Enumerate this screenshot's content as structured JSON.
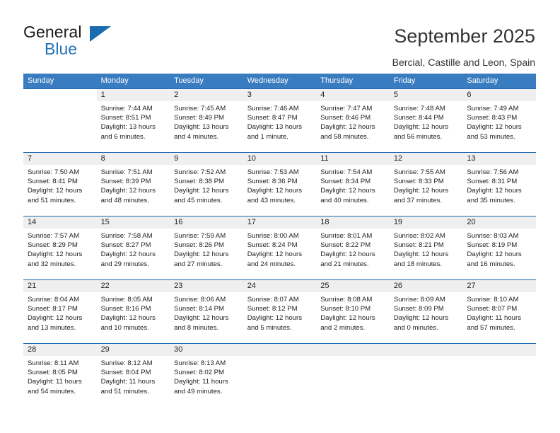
{
  "brand": {
    "line1": "General",
    "line2": "Blue",
    "accent": "#1b6cb0"
  },
  "header": {
    "title": "September 2025",
    "subtitle": "Bercial, Castille and Leon, Spain"
  },
  "calendar": {
    "header_bg": "#3a7cc0",
    "daynum_bg": "#efefef",
    "separator_color": "#1b6cb0",
    "weekdays": [
      "Sunday",
      "Monday",
      "Tuesday",
      "Wednesday",
      "Thursday",
      "Friday",
      "Saturday"
    ],
    "weeks": [
      [
        {
          "day": "",
          "blank": true,
          "sunrise": "",
          "sunset": "",
          "daylight1": "",
          "daylight2": ""
        },
        {
          "day": "1",
          "sunrise": "Sunrise: 7:44 AM",
          "sunset": "Sunset: 8:51 PM",
          "daylight1": "Daylight: 13 hours",
          "daylight2": "and 6 minutes."
        },
        {
          "day": "2",
          "sunrise": "Sunrise: 7:45 AM",
          "sunset": "Sunset: 8:49 PM",
          "daylight1": "Daylight: 13 hours",
          "daylight2": "and 4 minutes."
        },
        {
          "day": "3",
          "sunrise": "Sunrise: 7:46 AM",
          "sunset": "Sunset: 8:47 PM",
          "daylight1": "Daylight: 13 hours",
          "daylight2": "and 1 minute."
        },
        {
          "day": "4",
          "sunrise": "Sunrise: 7:47 AM",
          "sunset": "Sunset: 8:46 PM",
          "daylight1": "Daylight: 12 hours",
          "daylight2": "and 58 minutes."
        },
        {
          "day": "5",
          "sunrise": "Sunrise: 7:48 AM",
          "sunset": "Sunset: 8:44 PM",
          "daylight1": "Daylight: 12 hours",
          "daylight2": "and 56 minutes."
        },
        {
          "day": "6",
          "sunrise": "Sunrise: 7:49 AM",
          "sunset": "Sunset: 8:43 PM",
          "daylight1": "Daylight: 12 hours",
          "daylight2": "and 53 minutes."
        }
      ],
      [
        {
          "day": "7",
          "sunrise": "Sunrise: 7:50 AM",
          "sunset": "Sunset: 8:41 PM",
          "daylight1": "Daylight: 12 hours",
          "daylight2": "and 51 minutes."
        },
        {
          "day": "8",
          "sunrise": "Sunrise: 7:51 AM",
          "sunset": "Sunset: 8:39 PM",
          "daylight1": "Daylight: 12 hours",
          "daylight2": "and 48 minutes."
        },
        {
          "day": "9",
          "sunrise": "Sunrise: 7:52 AM",
          "sunset": "Sunset: 8:38 PM",
          "daylight1": "Daylight: 12 hours",
          "daylight2": "and 45 minutes."
        },
        {
          "day": "10",
          "sunrise": "Sunrise: 7:53 AM",
          "sunset": "Sunset: 8:36 PM",
          "daylight1": "Daylight: 12 hours",
          "daylight2": "and 43 minutes."
        },
        {
          "day": "11",
          "sunrise": "Sunrise: 7:54 AM",
          "sunset": "Sunset: 8:34 PM",
          "daylight1": "Daylight: 12 hours",
          "daylight2": "and 40 minutes."
        },
        {
          "day": "12",
          "sunrise": "Sunrise: 7:55 AM",
          "sunset": "Sunset: 8:33 PM",
          "daylight1": "Daylight: 12 hours",
          "daylight2": "and 37 minutes."
        },
        {
          "day": "13",
          "sunrise": "Sunrise: 7:56 AM",
          "sunset": "Sunset: 8:31 PM",
          "daylight1": "Daylight: 12 hours",
          "daylight2": "and 35 minutes."
        }
      ],
      [
        {
          "day": "14",
          "sunrise": "Sunrise: 7:57 AM",
          "sunset": "Sunset: 8:29 PM",
          "daylight1": "Daylight: 12 hours",
          "daylight2": "and 32 minutes."
        },
        {
          "day": "15",
          "sunrise": "Sunrise: 7:58 AM",
          "sunset": "Sunset: 8:27 PM",
          "daylight1": "Daylight: 12 hours",
          "daylight2": "and 29 minutes."
        },
        {
          "day": "16",
          "sunrise": "Sunrise: 7:59 AM",
          "sunset": "Sunset: 8:26 PM",
          "daylight1": "Daylight: 12 hours",
          "daylight2": "and 27 minutes."
        },
        {
          "day": "17",
          "sunrise": "Sunrise: 8:00 AM",
          "sunset": "Sunset: 8:24 PM",
          "daylight1": "Daylight: 12 hours",
          "daylight2": "and 24 minutes."
        },
        {
          "day": "18",
          "sunrise": "Sunrise: 8:01 AM",
          "sunset": "Sunset: 8:22 PM",
          "daylight1": "Daylight: 12 hours",
          "daylight2": "and 21 minutes."
        },
        {
          "day": "19",
          "sunrise": "Sunrise: 8:02 AM",
          "sunset": "Sunset: 8:21 PM",
          "daylight1": "Daylight: 12 hours",
          "daylight2": "and 18 minutes."
        },
        {
          "day": "20",
          "sunrise": "Sunrise: 8:03 AM",
          "sunset": "Sunset: 8:19 PM",
          "daylight1": "Daylight: 12 hours",
          "daylight2": "and 16 minutes."
        }
      ],
      [
        {
          "day": "21",
          "sunrise": "Sunrise: 8:04 AM",
          "sunset": "Sunset: 8:17 PM",
          "daylight1": "Daylight: 12 hours",
          "daylight2": "and 13 minutes."
        },
        {
          "day": "22",
          "sunrise": "Sunrise: 8:05 AM",
          "sunset": "Sunset: 8:16 PM",
          "daylight1": "Daylight: 12 hours",
          "daylight2": "and 10 minutes."
        },
        {
          "day": "23",
          "sunrise": "Sunrise: 8:06 AM",
          "sunset": "Sunset: 8:14 PM",
          "daylight1": "Daylight: 12 hours",
          "daylight2": "and 8 minutes."
        },
        {
          "day": "24",
          "sunrise": "Sunrise: 8:07 AM",
          "sunset": "Sunset: 8:12 PM",
          "daylight1": "Daylight: 12 hours",
          "daylight2": "and 5 minutes."
        },
        {
          "day": "25",
          "sunrise": "Sunrise: 8:08 AM",
          "sunset": "Sunset: 8:10 PM",
          "daylight1": "Daylight: 12 hours",
          "daylight2": "and 2 minutes."
        },
        {
          "day": "26",
          "sunrise": "Sunrise: 8:09 AM",
          "sunset": "Sunset: 8:09 PM",
          "daylight1": "Daylight: 12 hours",
          "daylight2": "and 0 minutes."
        },
        {
          "day": "27",
          "sunrise": "Sunrise: 8:10 AM",
          "sunset": "Sunset: 8:07 PM",
          "daylight1": "Daylight: 11 hours",
          "daylight2": "and 57 minutes."
        }
      ],
      [
        {
          "day": "28",
          "sunrise": "Sunrise: 8:11 AM",
          "sunset": "Sunset: 8:05 PM",
          "daylight1": "Daylight: 11 hours",
          "daylight2": "and 54 minutes."
        },
        {
          "day": "29",
          "sunrise": "Sunrise: 8:12 AM",
          "sunset": "Sunset: 8:04 PM",
          "daylight1": "Daylight: 11 hours",
          "daylight2": "and 51 minutes."
        },
        {
          "day": "30",
          "sunrise": "Sunrise: 8:13 AM",
          "sunset": "Sunset: 8:02 PM",
          "daylight1": "Daylight: 11 hours",
          "daylight2": "and 49 minutes."
        },
        {
          "day": "",
          "sunrise": "",
          "sunset": "",
          "daylight1": "",
          "daylight2": ""
        },
        {
          "day": "",
          "sunrise": "",
          "sunset": "",
          "daylight1": "",
          "daylight2": ""
        },
        {
          "day": "",
          "sunrise": "",
          "sunset": "",
          "daylight1": "",
          "daylight2": ""
        },
        {
          "day": "",
          "sunrise": "",
          "sunset": "",
          "daylight1": "",
          "daylight2": ""
        }
      ]
    ]
  }
}
